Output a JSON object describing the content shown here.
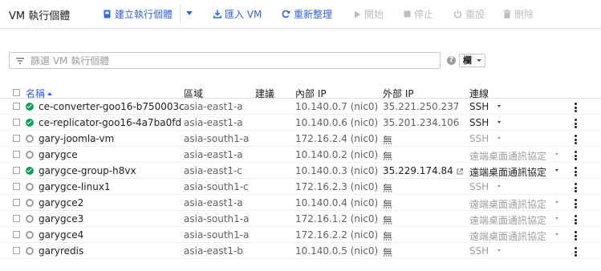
{
  "toolbar": {
    "title": "VM 執行個體",
    "create_label": "建立執行個體",
    "import_label": "匯入 VM",
    "refresh_label": "重新整理",
    "start_label": "開始",
    "stop_label": "停止",
    "reset_label": "重設",
    "delete_label": "刪除"
  },
  "filter": {
    "placeholder": "篩選 VM 執行個體",
    "columns_label": "欄"
  },
  "columns": {
    "name": "名稱",
    "zone": "區域",
    "recommendation": "建議",
    "internal_ip": "內部 IP",
    "external_ip": "外部 IP",
    "connect": "連線"
  },
  "colors": {
    "accent": "#3367d6",
    "running": "#0f9d58",
    "stopped": "#9e9e9e"
  },
  "instances": [
    {
      "name": "ce-converter-goo16-b750003c",
      "status": "running",
      "zone": "asia-east1-a",
      "internal_ip": "10.140.0.7 (nic0)",
      "external_ip": "35.221.250.237",
      "ext_link": false,
      "connect": "SSH",
      "connect_active": true
    },
    {
      "name": "ce-replicator-goo16-4a7ba0fd",
      "status": "running",
      "zone": "asia-east1-a",
      "internal_ip": "10.140.0.6 (nic0)",
      "external_ip": "35.201.234.106",
      "ext_link": false,
      "connect": "SSH",
      "connect_active": true
    },
    {
      "name": "gary-joomla-vm",
      "status": "stopped",
      "zone": "asia-south1-a",
      "internal_ip": "172.16.2.4 (nic0)",
      "external_ip": "無",
      "ext_link": false,
      "connect": "SSH",
      "connect_active": false
    },
    {
      "name": "garygce",
      "status": "stopped",
      "zone": "asia-east1-a",
      "internal_ip": "10.140.0.2 (nic0)",
      "external_ip": "無",
      "ext_link": false,
      "connect": "遠端桌面通訊協定",
      "connect_active": false
    },
    {
      "name": "garygce-group-h8vx",
      "status": "running",
      "zone": "asia-east1-c",
      "internal_ip": "10.140.0.3 (nic0)",
      "external_ip": "35.229.174.84",
      "ext_link": true,
      "connect": "遠端桌面通訊協定",
      "connect_active": true
    },
    {
      "name": "garygce-linux1",
      "status": "stopped",
      "zone": "asia-south1-c",
      "internal_ip": "172.16.2.3 (nic0)",
      "external_ip": "無",
      "ext_link": false,
      "connect": "SSH",
      "connect_active": false
    },
    {
      "name": "garygce2",
      "status": "stopped",
      "zone": "asia-east1-a",
      "internal_ip": "10.140.0.4 (nic0)",
      "external_ip": "無",
      "ext_link": false,
      "connect": "遠端桌面通訊協定",
      "connect_active": false
    },
    {
      "name": "garygce3",
      "status": "stopped",
      "zone": "asia-south1-a",
      "internal_ip": "172.16.1.2 (nic0)",
      "external_ip": "無",
      "ext_link": false,
      "connect": "遠端桌面通訊協定",
      "connect_active": false
    },
    {
      "name": "garygce4",
      "status": "stopped",
      "zone": "asia-south1-a",
      "internal_ip": "172.16.2.2 (nic0)",
      "external_ip": "無",
      "ext_link": false,
      "connect": "遠端桌面通訊協定",
      "connect_active": false
    },
    {
      "name": "garyredis",
      "status": "stopped",
      "zone": "asia-east1-b",
      "internal_ip": "10.140.0.5 (nic0)",
      "external_ip": "無",
      "ext_link": false,
      "connect": "SSH",
      "connect_active": false
    }
  ]
}
